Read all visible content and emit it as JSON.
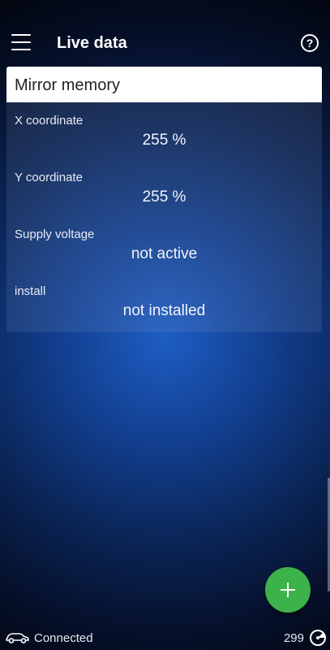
{
  "header": {
    "title": "Live data",
    "help_label": "?"
  },
  "card": {
    "title": "Mirror memory",
    "rows": [
      {
        "label": "X coordinate",
        "value": "255 %"
      },
      {
        "label": "Y coordinate",
        "value": "255 %"
      },
      {
        "label": "Supply voltage",
        "value": "not active"
      },
      {
        "label": "install",
        "value": "not installed"
      }
    ]
  },
  "fab": {
    "icon": "plus-icon"
  },
  "status": {
    "connection": "Connected",
    "count": "299",
    "car_icon": "car-icon",
    "gauge_icon": "gauge-icon"
  },
  "colors": {
    "fab": "#3cb34a",
    "background_center": "#1e5dc4",
    "background_edge": "#02060f"
  }
}
